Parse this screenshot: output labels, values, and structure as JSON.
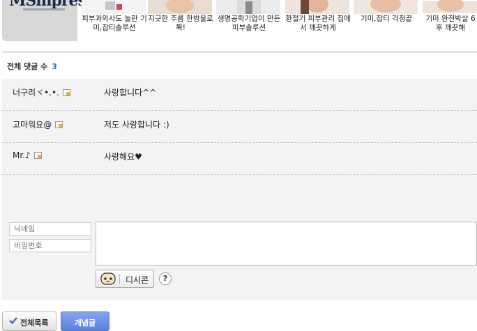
{
  "ad_strip": {
    "logo_text": "MSmpress",
    "items": [
      {
        "caption": "피부과의사도 놀란 기미,잡티솔루션"
      },
      {
        "caption": "지긋한 주름 한방울로 쫙!"
      },
      {
        "caption": "생명공학기업이 만든 피부솔루션"
      },
      {
        "caption": "환절기 피부관리 집에서 깨끗하게"
      },
      {
        "caption": "기미,잡티 걱정끝"
      },
      {
        "caption": "기미 완전박살 6 후 깨끗해"
      }
    ]
  },
  "comments": {
    "count_label": "전체 댓글 수",
    "count": "3",
    "items": [
      {
        "nick": "너구리ヾ•.•.",
        "text": "사랑합니다^^"
      },
      {
        "nick": "고마워요@",
        "text": "저도 사랑합니다 :)"
      },
      {
        "nick": "Mr.♪",
        "text": "사랑해요♥"
      }
    ]
  },
  "form": {
    "nick_placeholder": "닉네임",
    "password_placeholder": "비밀번호",
    "dccon_label": "디시콘",
    "help_label": "?"
  },
  "buttons": {
    "list_label": "전체목록",
    "submit_label": "개념글"
  },
  "colors": {
    "accent": "#3a6ea5",
    "submit_bg": "#6f8fe6",
    "comment_bg": "#f3f3f3"
  }
}
